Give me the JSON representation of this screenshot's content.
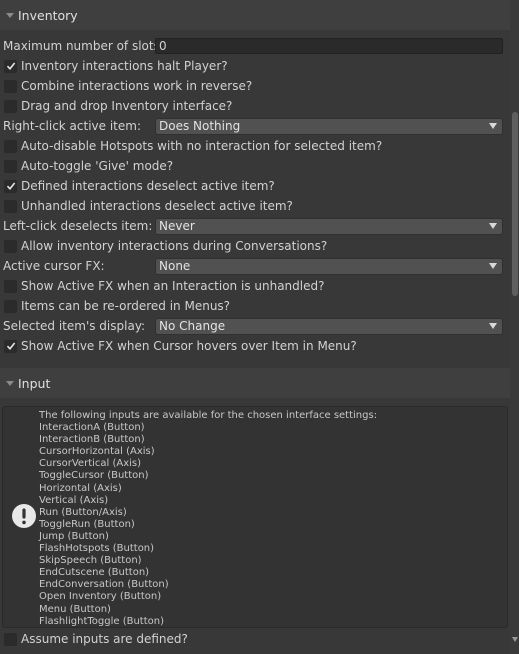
{
  "inventory": {
    "header": "Inventory",
    "max_slots_label": "Maximum number of slots:",
    "max_slots_value": "0",
    "rows": [
      {
        "type": "checkbox",
        "label": "Inventory interactions halt Player?",
        "checked": true
      },
      {
        "type": "checkbox",
        "label": "Combine interactions work in reverse?",
        "checked": false
      },
      {
        "type": "checkbox",
        "label": "Drag and drop Inventory interface?",
        "checked": false
      }
    ],
    "right_click_label": "Right-click active item:",
    "right_click_value": "Does Nothing",
    "rows2": [
      {
        "label": "Auto-disable Hotspots with no interaction for selected item?",
        "checked": false
      },
      {
        "label": "Auto-toggle 'Give' mode?",
        "checked": false
      },
      {
        "label": "Defined interactions deselect active item?",
        "checked": true
      },
      {
        "label": "Unhandled interactions deselect active item?",
        "checked": false
      }
    ],
    "left_click_label": "Left-click deselects item:",
    "left_click_value": "Never",
    "allow_conversations_label": "Allow inventory interactions during Conversations?",
    "allow_conversations_checked": false,
    "cursor_fx_label": "Active cursor FX:",
    "cursor_fx_value": "None",
    "show_fx_unhandled_label": "Show Active FX when an Interaction is unhandled?",
    "reorder_label": "Items can be re-ordered in Menus?",
    "selected_display_label": "Selected item's display:",
    "selected_display_value": "No Change",
    "show_fx_hover_label": "Show Active FX when Cursor hovers over Item in Menu?"
  },
  "input": {
    "header": "Input",
    "help_lines": [
      "The following inputs are available for the chosen interface settings:",
      "InteractionA (Button)",
      "InteractionB (Button)",
      "CursorHorizontal (Axis)",
      "CursorVertical (Axis)",
      "ToggleCursor (Button)",
      "Horizontal (Axis)",
      "Vertical (Axis)",
      "Run (Button/Axis)",
      "ToggleRun (Button)",
      "Jump (Button)",
      "FlashHotspots (Button)",
      "SkipSpeech (Button)",
      "EndCutscene (Button)",
      "EndConversation (Button)",
      "Open Inventory (Button)",
      "Menu (Button)",
      "FlashlightToggle (Button)"
    ],
    "assume_defined_label": "Assume inputs are defined?"
  },
  "colors": {
    "background": "#383838",
    "header_bg": "#3f3f3f",
    "dropdown_bg": "#515151",
    "input_bg": "#2a2a2a",
    "text": "#d2d2d2"
  },
  "icons": {
    "foldout": "triangle-down-icon",
    "check": "checkmark-icon",
    "help": "exclamation-info-icon",
    "dropdown": "chevron-down-icon"
  }
}
